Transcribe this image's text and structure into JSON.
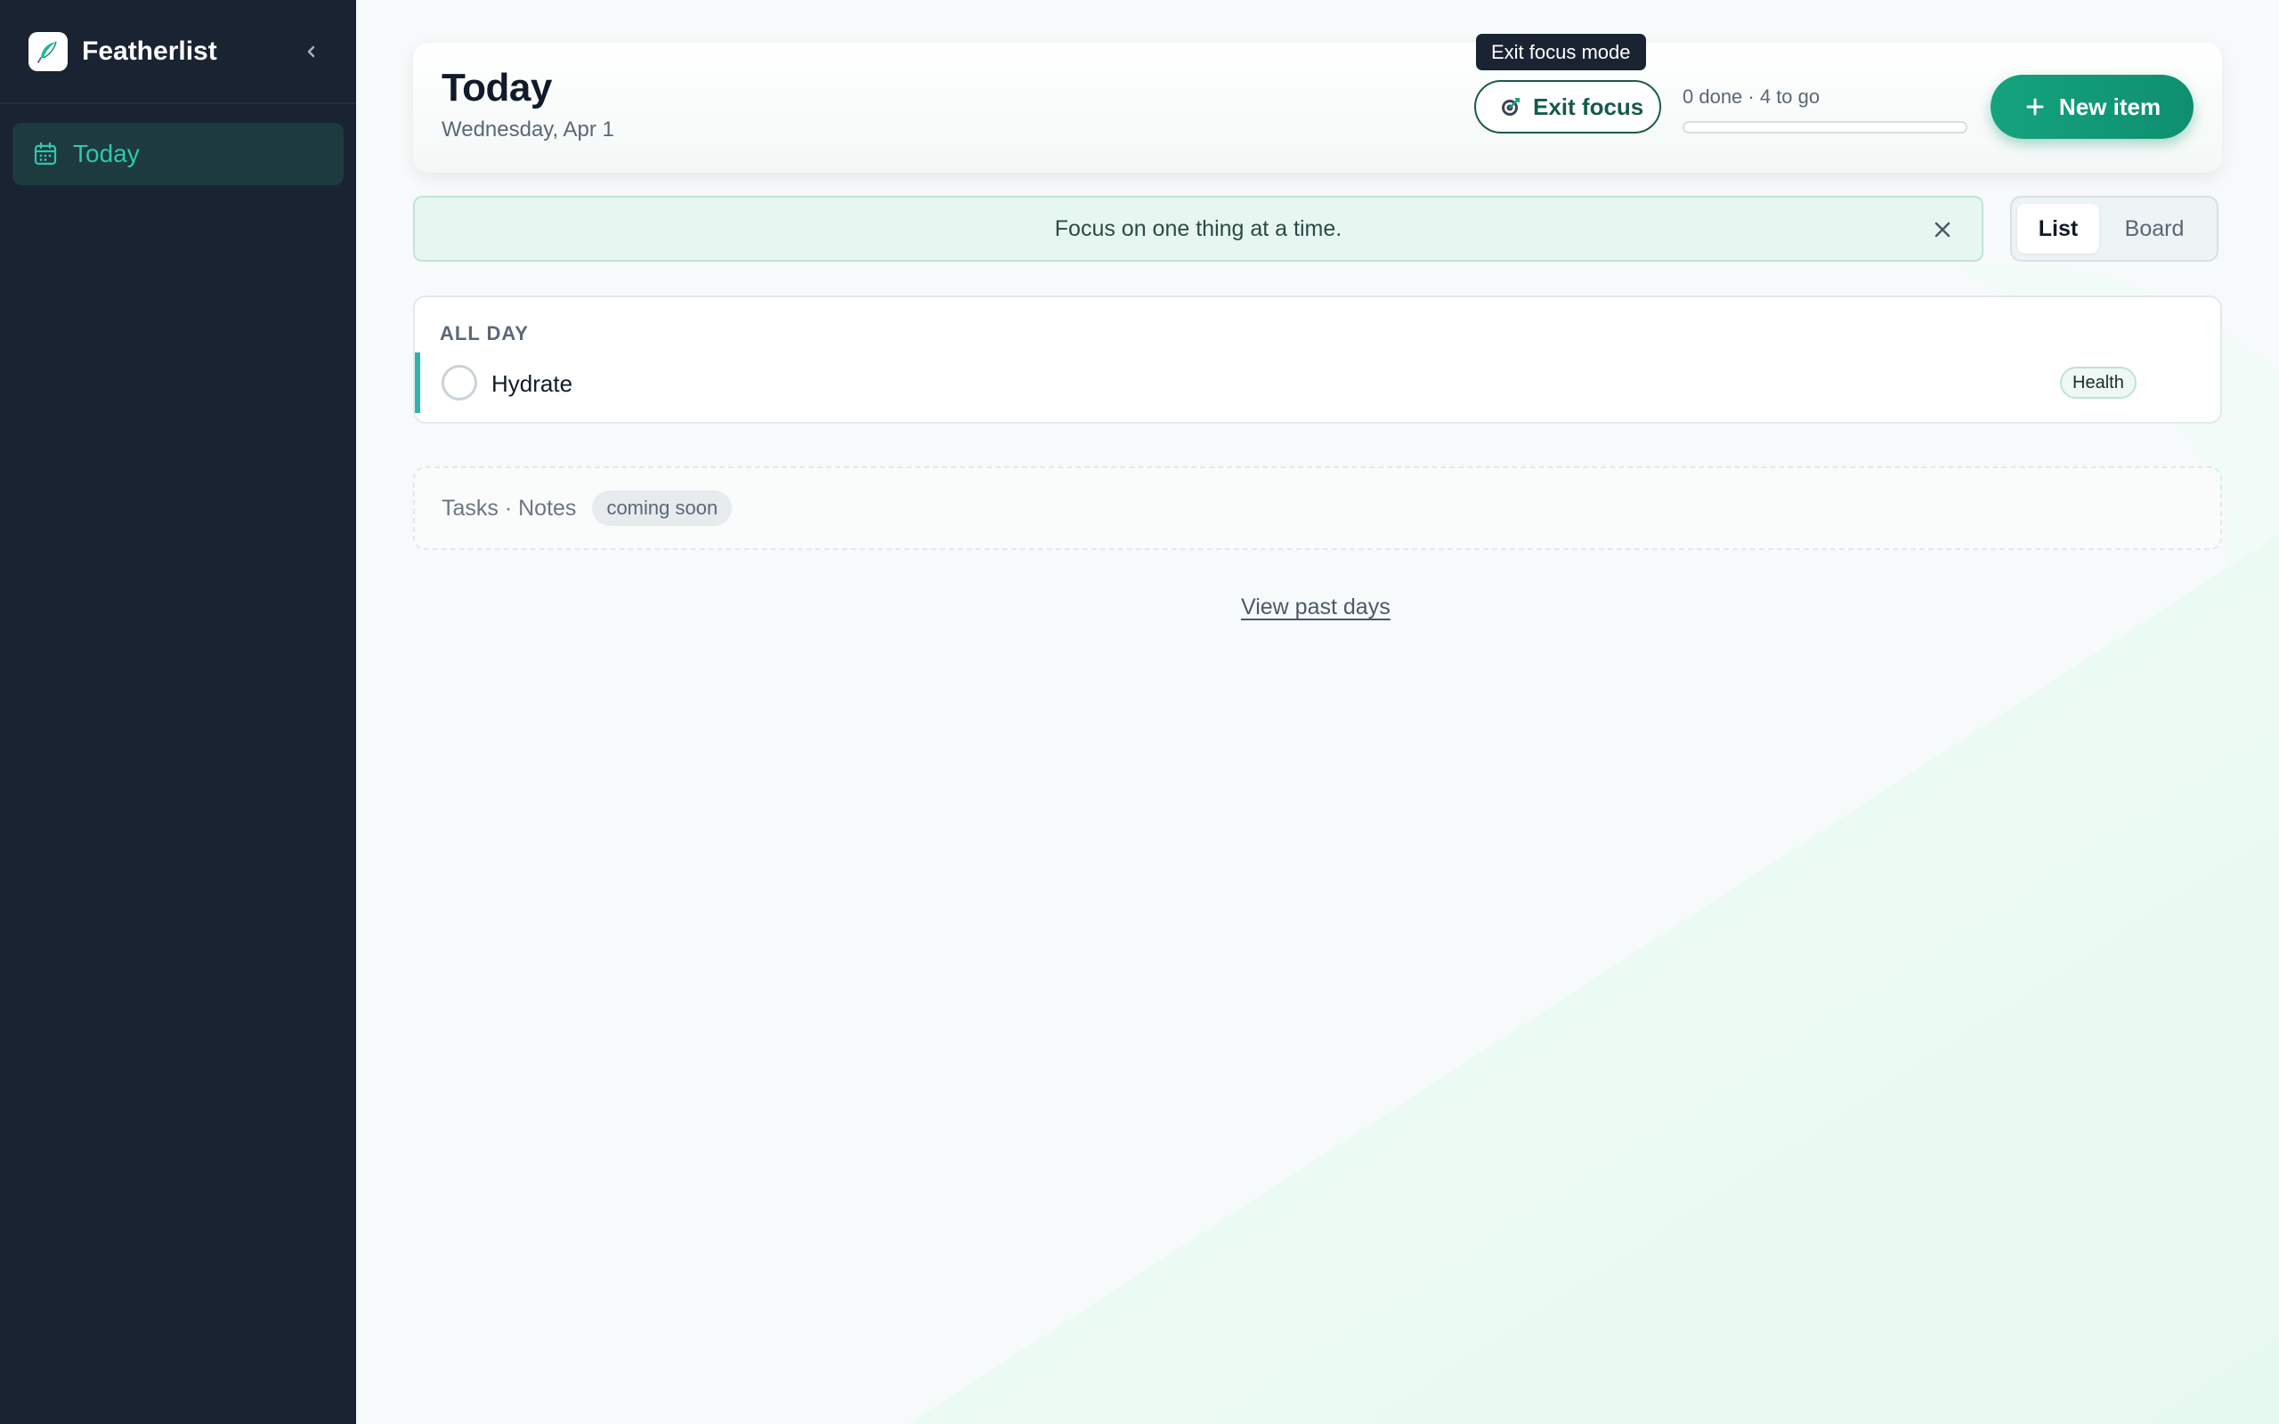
{
  "app": {
    "name": "Featherlist"
  },
  "sidebar": {
    "items": [
      {
        "label": "Today"
      }
    ]
  },
  "header": {
    "title": "Today",
    "date": "Wednesday, Apr 1",
    "tooltip": "Exit focus mode",
    "exit_focus_label": "Exit focus",
    "progress_text": "0 done · 4 to go",
    "progress_fraction": 0,
    "new_item_label": "New item"
  },
  "banner": {
    "text": "Focus on one thing at a time."
  },
  "view_toggle": {
    "options": [
      "List",
      "Board"
    ],
    "selected": "List"
  },
  "all_day": {
    "heading": "ALL DAY",
    "tasks": [
      {
        "title": "Hydrate",
        "tag": "Health",
        "done": false
      }
    ]
  },
  "placeholder": {
    "text": "Tasks · Notes",
    "badge": "coming soon"
  },
  "footer": {
    "past_days_link": "View past days"
  },
  "colors": {
    "sidebar_bg": "#1a2332",
    "accent": "#14a37f",
    "nav_active_text": "#2fc7ad",
    "task_accent": "#2fb4ad"
  }
}
